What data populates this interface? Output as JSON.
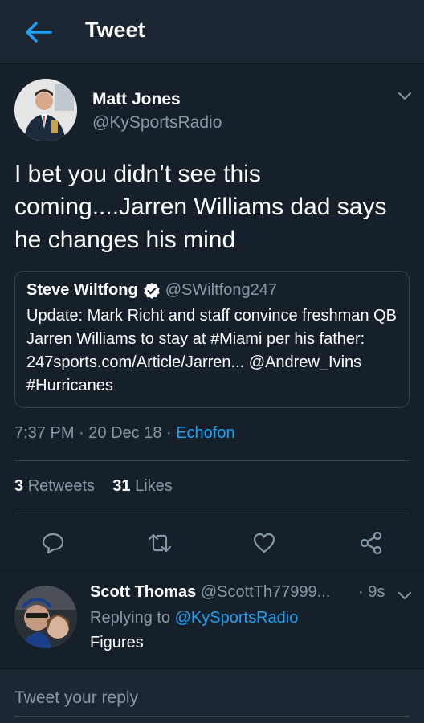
{
  "header": {
    "title": "Tweet"
  },
  "tweet": {
    "author_name": "Matt Jones",
    "author_handle": "@KySportsRadio",
    "text": "I bet you didn’t see this coming....Jarren Williams dad says he changes his mind",
    "quote": {
      "name": "Steve Wiltfong",
      "handle": "@SWiltfong247",
      "text": "Update: Mark Richt and staff convince freshman QB Jarren Williams to stay at #Miami per his father: 247sports.com/Article/Jarren... @Andrew_Ivins #Hurricanes"
    },
    "time": "7:37 PM",
    "date": "20 Dec 18",
    "source": "Echofon",
    "retweets_count": "3",
    "retweets_label": "Retweets",
    "likes_count": "31",
    "likes_label": "Likes"
  },
  "reply": {
    "name": "Scott Thomas",
    "handle": "@ScottTh77999...",
    "time": "9s",
    "replying_prefix": "Replying to",
    "replying_to": "@KySportsRadio",
    "text": "Figures"
  },
  "compose": {
    "placeholder": "Tweet your reply"
  },
  "icons": {
    "back": "arrow-left-icon",
    "caret": "chevron-down-icon",
    "verified": "verified-badge-icon",
    "reply": "comment-icon",
    "retweet": "retweet-icon",
    "like": "heart-icon",
    "share": "share-icon"
  },
  "colors": {
    "background": "#15202b",
    "header": "#1c2733",
    "accent": "#1da1f2",
    "secondary_text": "#8899a6",
    "border": "#38444d"
  }
}
